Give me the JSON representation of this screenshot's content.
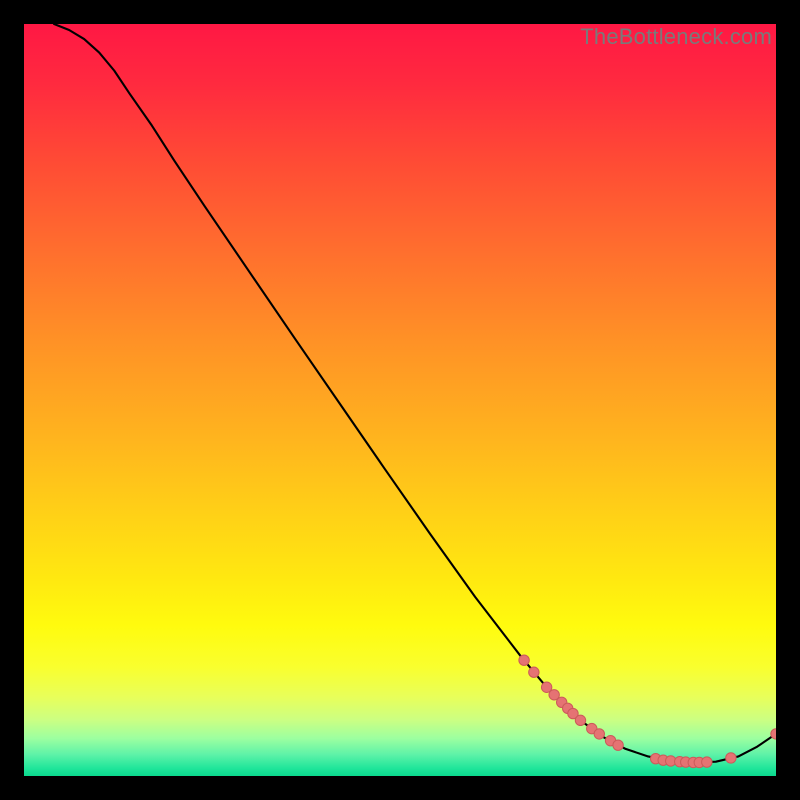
{
  "watermark": "TheBottleneck.com",
  "chart_data": {
    "type": "line",
    "title": "",
    "xlabel": "",
    "ylabel": "",
    "xlim": [
      0,
      100
    ],
    "ylim": [
      0,
      100
    ],
    "grid": false,
    "legend": false,
    "gradient_stops": [
      {
        "offset": 0.0,
        "color": "#ff1844"
      },
      {
        "offset": 0.08,
        "color": "#ff2a3f"
      },
      {
        "offset": 0.18,
        "color": "#ff4a35"
      },
      {
        "offset": 0.3,
        "color": "#ff6e2e"
      },
      {
        "offset": 0.42,
        "color": "#ff9126"
      },
      {
        "offset": 0.55,
        "color": "#ffb41e"
      },
      {
        "offset": 0.66,
        "color": "#ffd316"
      },
      {
        "offset": 0.74,
        "color": "#ffe910"
      },
      {
        "offset": 0.8,
        "color": "#fffb0e"
      },
      {
        "offset": 0.855,
        "color": "#f9ff2e"
      },
      {
        "offset": 0.895,
        "color": "#e8ff5a"
      },
      {
        "offset": 0.925,
        "color": "#ccff82"
      },
      {
        "offset": 0.95,
        "color": "#9cffa0"
      },
      {
        "offset": 0.972,
        "color": "#5cf2a8"
      },
      {
        "offset": 0.99,
        "color": "#1fe59a"
      },
      {
        "offset": 1.0,
        "color": "#0bd98e"
      }
    ],
    "series": [
      {
        "name": "curve",
        "stroke": "#000000",
        "stroke_width": 2.1,
        "x": [
          4,
          6,
          8,
          10,
          12,
          14,
          17,
          20,
          24,
          30,
          36,
          42,
          48,
          54,
          60,
          66,
          70,
          74,
          77,
          80,
          83,
          86,
          89,
          92,
          95,
          97.5,
          100
        ],
        "y": [
          100,
          99.2,
          98.0,
          96.2,
          93.8,
          90.8,
          86.5,
          81.8,
          75.8,
          67.0,
          58.2,
          49.5,
          40.8,
          32.2,
          23.8,
          16.0,
          11.2,
          7.4,
          5.2,
          3.6,
          2.6,
          2.0,
          1.8,
          1.9,
          2.6,
          3.9,
          5.6
        ]
      }
    ],
    "scatter_points": {
      "name": "markers",
      "fill": "#e57373",
      "stroke": "#cc5a5a",
      "radius": 5.2,
      "cluster_a": {
        "x": [
          66.5,
          67.8,
          69.5,
          70.5,
          71.5,
          72.3,
          73.0,
          74.0,
          75.5,
          76.5,
          78.0,
          79.0
        ],
        "y": [
          15.4,
          13.8,
          11.8,
          10.8,
          9.8,
          9.0,
          8.3,
          7.4,
          6.3,
          5.6,
          4.7,
          4.1
        ]
      },
      "cluster_b": {
        "x": [
          84.0,
          85.0,
          86.0,
          87.2,
          88.0,
          89.0,
          89.8,
          90.8,
          94.0,
          100.0
        ],
        "y": [
          2.3,
          2.1,
          2.0,
          1.9,
          1.85,
          1.8,
          1.8,
          1.85,
          2.4,
          5.6
        ]
      }
    }
  }
}
